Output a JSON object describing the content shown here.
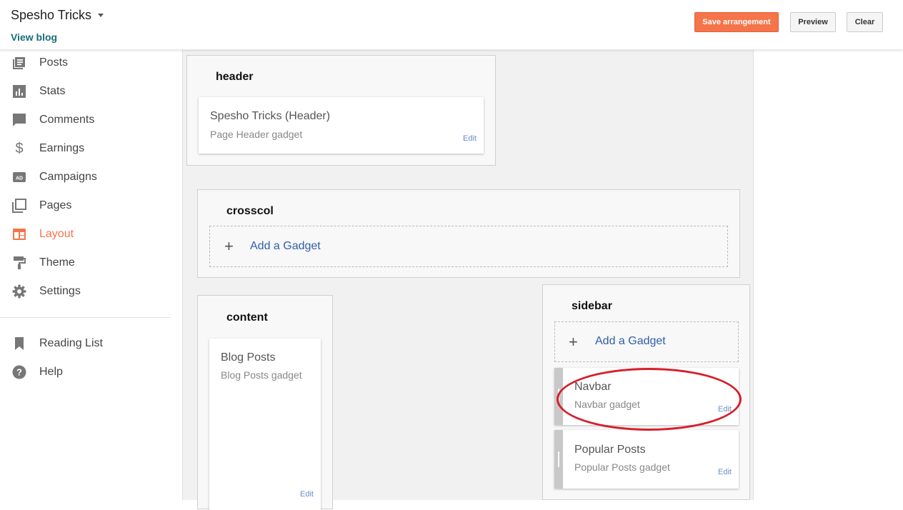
{
  "header": {
    "blog_title": "Spesho Tricks",
    "view_blog": "View blog",
    "save_label": "Save arrangement",
    "preview_label": "Preview",
    "clear_label": "Clear",
    "accent": "#f5744a"
  },
  "nav": {
    "items": [
      {
        "label": "Posts",
        "icon": "posts-icon"
      },
      {
        "label": "Stats",
        "icon": "stats-icon"
      },
      {
        "label": "Comments",
        "icon": "comments-icon"
      },
      {
        "label": "Earnings",
        "icon": "dollar-icon"
      },
      {
        "label": "Campaigns",
        "icon": "ad-icon"
      },
      {
        "label": "Pages",
        "icon": "pages-icon"
      },
      {
        "label": "Layout",
        "icon": "layout-icon",
        "active": true
      },
      {
        "label": "Theme",
        "icon": "paint-roller-icon"
      },
      {
        "label": "Settings",
        "icon": "gear-icon"
      }
    ],
    "secondary": [
      {
        "label": "Reading List",
        "icon": "bookmark-icon"
      },
      {
        "label": "Help",
        "icon": "help-icon"
      }
    ]
  },
  "layout": {
    "header_section": {
      "title": "header",
      "gadget": {
        "title": "Spesho Tricks (Header)",
        "subtitle": "Page Header gadget",
        "edit": "Edit"
      }
    },
    "crosscol_section": {
      "title": "crosscol",
      "add_gadget": "Add a Gadget"
    },
    "content_section": {
      "title": "content",
      "gadget": {
        "title": "Blog Posts",
        "subtitle": "Blog Posts gadget",
        "edit": "Edit"
      }
    },
    "sidebar_section": {
      "title": "sidebar",
      "add_gadget": "Add a Gadget",
      "gadgets": [
        {
          "title": "Navbar",
          "subtitle": "Navbar gadget",
          "edit": "Edit"
        },
        {
          "title": "Popular Posts",
          "subtitle": "Popular Posts gadget",
          "edit": "Edit"
        }
      ]
    }
  },
  "annotation": {
    "color": "#d61f2a"
  }
}
